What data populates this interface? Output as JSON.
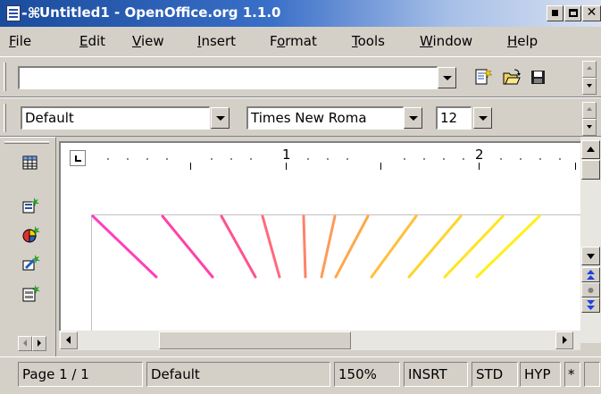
{
  "window": {
    "title": "Untitled1 - OpenOffice.org 1.1.0",
    "pin_glyph": "-⌘"
  },
  "menu": {
    "items": [
      {
        "label": "File",
        "ul": "F",
        "rest": "ile"
      },
      {
        "label": "Edit",
        "ul": "E",
        "rest": "dit"
      },
      {
        "label": "View",
        "ul": "V",
        "rest": "iew"
      },
      {
        "label": "Insert",
        "ul": "I",
        "rest": "nsert"
      },
      {
        "label": "Format",
        "pre": "F",
        "ul": "o",
        "rest": "rmat"
      },
      {
        "label": "Tools",
        "ul": "T",
        "rest": "ools"
      },
      {
        "label": "Window",
        "ul": "W",
        "rest": "indow"
      },
      {
        "label": "Help",
        "ul": "H",
        "rest": "elp"
      }
    ]
  },
  "function_bar": {
    "url_value": "",
    "icons": [
      "new-document-icon",
      "open-folder-icon",
      "save-disk-icon"
    ]
  },
  "object_bar": {
    "paragraph_style": "Default",
    "font_name": "Times New Roma",
    "font_size": "12"
  },
  "ruler": {
    "labels": [
      "1",
      "2"
    ]
  },
  "left_toolbar": {
    "icons": [
      "insert-table-icon",
      "insert-fields-icon",
      "insert-chart-icon",
      "insert-draw-icon",
      "insert-form-icon"
    ]
  },
  "document": {
    "lines": [
      {
        "color": "#ff3fbf",
        "angle": -31
      },
      {
        "color": "#ff42a8",
        "angle": -33
      },
      {
        "color": "#ff5290",
        "angle": -30
      },
      {
        "color": "#ff6a7a",
        "angle": -21
      },
      {
        "color": "#ff8268",
        "angle": -5
      },
      {
        "color": "#ff9a58",
        "angle": 5
      },
      {
        "color": "#ffa848",
        "angle": 20
      },
      {
        "color": "#ffbf3a",
        "angle": 30
      },
      {
        "color": "#ffd42e",
        "angle": 33
      },
      {
        "color": "#ffe422",
        "angle": 35
      },
      {
        "color": "#fff018",
        "angle": 38
      }
    ]
  },
  "status": {
    "page": "Page 1 / 1",
    "style": "Default",
    "zoom": "150%",
    "insert_mode": "INSRT",
    "selection_mode": "STD",
    "hyperlink_mode": "HYP",
    "modified": "*"
  }
}
